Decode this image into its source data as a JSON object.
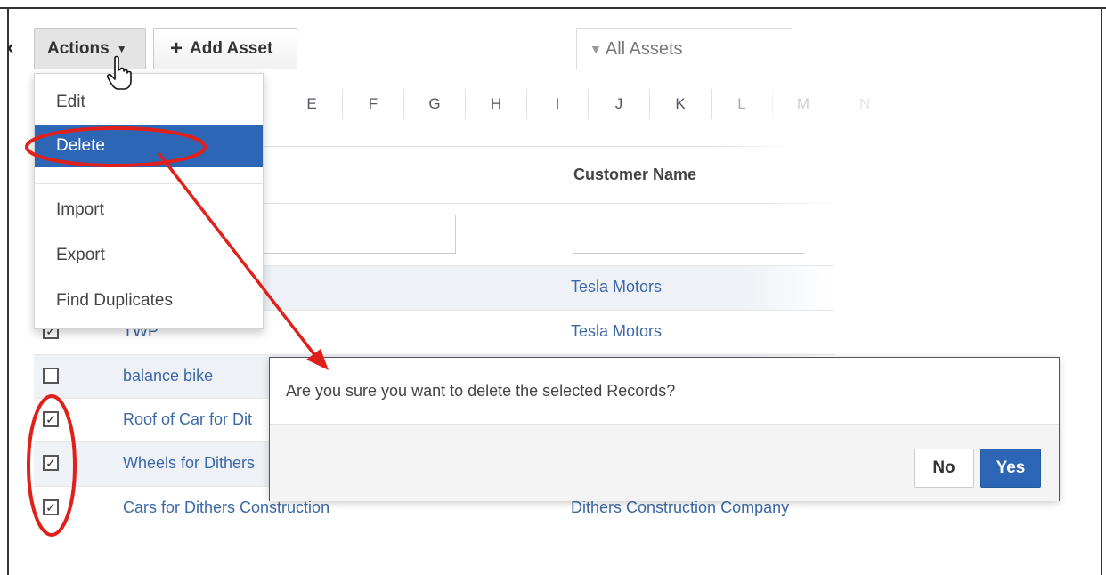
{
  "toolbar": {
    "actions_label": "Actions",
    "add_asset_label": "Add Asset",
    "filter_label": "All Assets"
  },
  "alphabet": [
    "E",
    "F",
    "G",
    "H",
    "I",
    "J",
    "K",
    "L",
    "M",
    "N"
  ],
  "table": {
    "customer_header": "Customer Name",
    "rows": [
      {
        "asset": "",
        "customer": "Tesla Motors",
        "checked": false
      },
      {
        "asset": "TWP",
        "customer": "Tesla Motors",
        "checked": true
      },
      {
        "asset": "balance bike",
        "customer": "",
        "checked": false
      },
      {
        "asset": "Roof of Car for Dit",
        "customer": "",
        "checked": true
      },
      {
        "asset": "Wheels for Dithers",
        "customer": "",
        "checked": true
      },
      {
        "asset": "Cars for Dithers Construction",
        "customer": "Dithers Construction Company",
        "checked": true
      }
    ]
  },
  "menu": {
    "items": [
      {
        "label": "Edit"
      },
      {
        "label": "Delete"
      },
      {
        "label": "Import"
      },
      {
        "label": "Export"
      },
      {
        "label": "Find Duplicates"
      }
    ],
    "active_index": 1
  },
  "dialog": {
    "message": "Are you sure you want to delete the selected Records?",
    "no_label": "No",
    "yes_label": "Yes"
  },
  "colors": {
    "accent": "#2c66b5",
    "link": "#3b68a8",
    "annotation": "#e0201a"
  }
}
